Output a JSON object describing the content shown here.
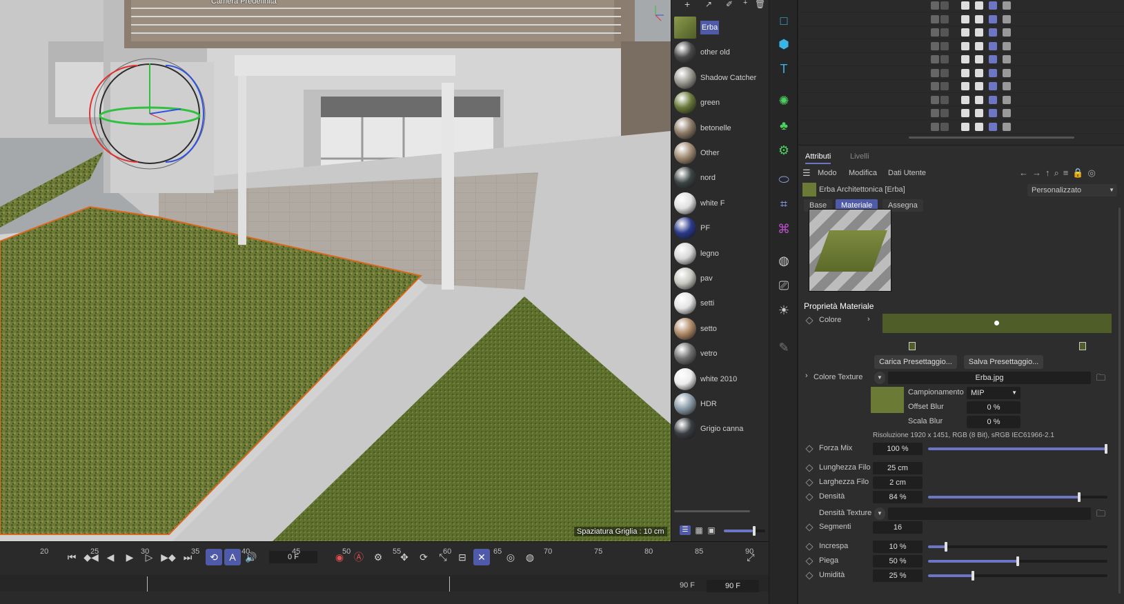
{
  "viewport": {
    "camera_label": "Camera Predefinita",
    "grid_label": "Spaziatura Griglia : 10 cm"
  },
  "materials": [
    {
      "name": "Erba",
      "color": "#7d8a3f",
      "selected": true
    },
    {
      "name": "other old",
      "color": "#4a4a4a"
    },
    {
      "name": "Shadow Catcher",
      "color": "#9a9890"
    },
    {
      "name": "green",
      "color": "#6a7a3a"
    },
    {
      "name": "betonelle",
      "color": "#8c7a66"
    },
    {
      "name": "Other",
      "color": "#a08a72"
    },
    {
      "name": "nord",
      "color": "#3c4444"
    },
    {
      "name": "white F",
      "color": "#e0e0e0"
    },
    {
      "name": "PF",
      "color": "#2a3a8a"
    },
    {
      "name": "legno",
      "color": "#d8d8d8"
    },
    {
      "name": "pav",
      "color": "#c8c8c0"
    },
    {
      "name": "setti",
      "color": "#e4e4e4"
    },
    {
      "name": "setto",
      "color": "#b08a68"
    },
    {
      "name": "vetro",
      "color": "#707070"
    },
    {
      "name": "white 2010",
      "color": "#ececec"
    },
    {
      "name": "HDR",
      "color": "#8a9aa8"
    },
    {
      "name": "Grigio canna",
      "color": "#3a3e42"
    }
  ],
  "attributes": {
    "tabs_top": [
      "Attributi",
      "Livelli"
    ],
    "menu": [
      "Modo",
      "Modifica",
      "Dati Utente"
    ],
    "object_title": "Erba Architettonica [Erba]",
    "preset": "Personalizzato",
    "subtabs": [
      "Base",
      "Materiale",
      "Assegna"
    ],
    "section_title": "Proprietà Materiale",
    "colore_label": "Colore",
    "colore_value": "#4f5e28",
    "load_preset": "Carica Presettaggio...",
    "save_preset": "Salva Presettaggio...",
    "texture_label": "Colore Texture",
    "texture_file": "Erba.jpg",
    "campionamento_label": "Campionamento",
    "campionamento_value": "MIP",
    "offset_blur_label": "Offset Blur",
    "offset_blur_value": "0 %",
    "scala_blur_label": "Scala Blur",
    "scala_blur_value": "0 %",
    "resolution": "Risoluzione 1920 x 1451, RGB (8 Bit), sRGB IEC61966-2.1",
    "params": [
      {
        "label": "Forza Mix",
        "value": "100 %",
        "fraction": 1.0
      },
      {
        "label": "Lunghezza Filo",
        "value": "25 cm"
      },
      {
        "label": "Larghezza Filo",
        "value": "2 cm"
      },
      {
        "label": "Densità",
        "value": "84 %",
        "fraction": 0.84
      }
    ],
    "densita_texture_label": "Densità Texture",
    "segmenti_label": "Segmenti",
    "segmenti_value": "16",
    "params2": [
      {
        "label": "Increspa",
        "value": "10 %",
        "fraction": 0.1
      },
      {
        "label": "Piega",
        "value": "50 %",
        "fraction": 0.5
      },
      {
        "label": "Umidità",
        "value": "25 %",
        "fraction": 0.25
      }
    ]
  },
  "timeline": {
    "current_frame": "0 F",
    "end_frame_a": "90 F",
    "end_frame_b": "90 F",
    "ruler": [
      "20",
      "25",
      "30",
      "35",
      "40",
      "45",
      "50",
      "55",
      "60",
      "65",
      "70",
      "75",
      "80",
      "85",
      "90"
    ]
  }
}
